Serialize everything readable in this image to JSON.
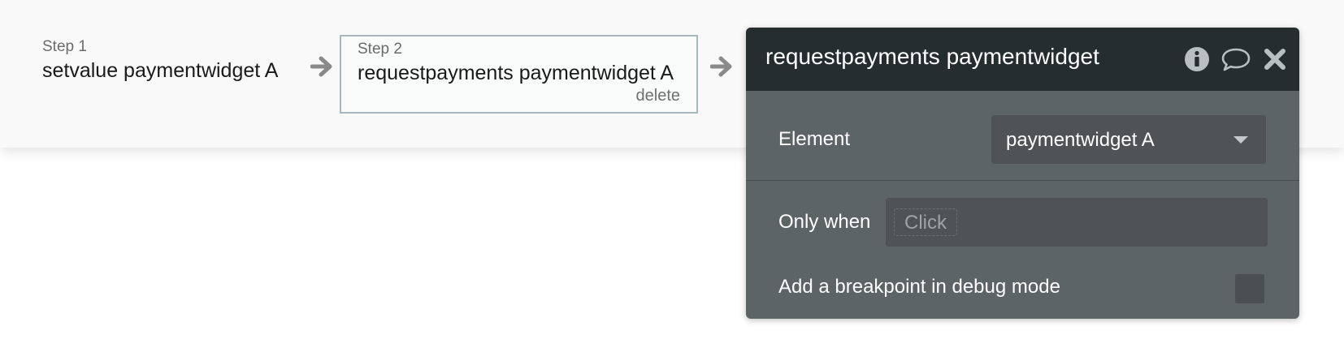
{
  "workflow": {
    "steps": [
      {
        "label": "Step 1",
        "name": "setvalue paymentwidget A"
      },
      {
        "label": "Step 2",
        "name": "requestpayments paymentwidget A",
        "delete_label": "delete"
      }
    ]
  },
  "panel": {
    "title": "requestpayments paymentwidget",
    "icons": [
      "info-icon",
      "comment-icon",
      "close-icon"
    ],
    "element": {
      "label": "Element",
      "value": "paymentwidget A"
    },
    "only_when": {
      "label": "Only when",
      "placeholder": "Click"
    },
    "breakpoint": {
      "label": "Add a breakpoint in debug mode",
      "checked": false
    }
  },
  "colors": {
    "panel_header": "#252d2f",
    "panel_body": "#5d6466",
    "field_bg": "#4f5355",
    "step_border": "#a9b7bd"
  }
}
